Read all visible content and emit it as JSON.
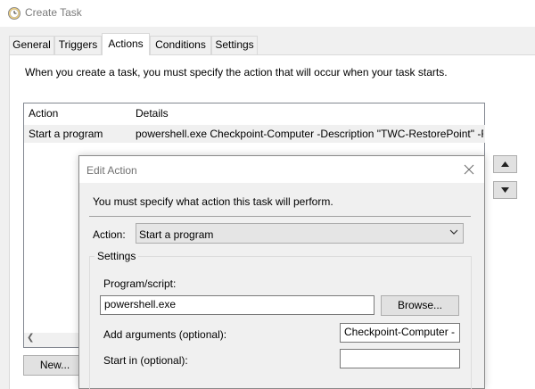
{
  "window": {
    "title": "Create Task"
  },
  "tabs": [
    "General",
    "Triggers",
    "Actions",
    "Conditions",
    "Settings"
  ],
  "active_tab": "Actions",
  "intro": "When you create a task, you must specify the action that will occur when your task starts.",
  "actions_table": {
    "columns": [
      "Action",
      "Details"
    ],
    "rows": [
      {
        "action": "Start a program",
        "details": "powershell.exe Checkpoint-Computer -Description \"TWC-RestorePoint\" -R"
      }
    ]
  },
  "buttons": {
    "new": "New..."
  },
  "dialog": {
    "title": "Edit Action",
    "message": "You must specify what action this task will perform.",
    "action_label": "Action:",
    "action_value": "Start a program",
    "settings_label": "Settings",
    "program_label": "Program/script:",
    "program_value": "powershell.exe",
    "browse": "Browse...",
    "args_label": "Add arguments (optional):",
    "args_value": "Checkpoint-Computer -",
    "startin_label": "Start in (optional):",
    "startin_value": ""
  },
  "colors": {
    "window": "#f0f0f0",
    "panel": "#ffffff",
    "border": "#adadad"
  }
}
